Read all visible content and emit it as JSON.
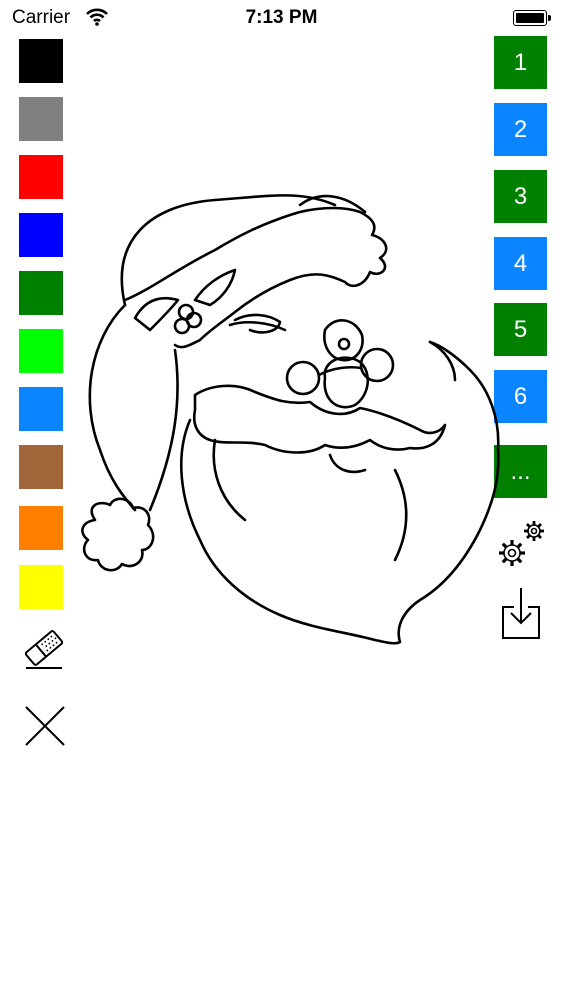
{
  "status_bar": {
    "carrier": "Carrier",
    "time": "7:13 PM",
    "icons": [
      "wifi-icon",
      "battery-icon"
    ]
  },
  "palette": {
    "colors": [
      "#000000",
      "#808080",
      "#ff0000",
      "#0000ff",
      "#008000",
      "#00ff00",
      "#0a84ff",
      "#a0663a",
      "#ff8000",
      "#ffff00"
    ],
    "tools": [
      "eraser-icon",
      "clear-icon"
    ]
  },
  "pages": {
    "buttons": [
      {
        "label": "1",
        "color": "#008000"
      },
      {
        "label": "2",
        "color": "#0a84ff"
      },
      {
        "label": "3",
        "color": "#008000"
      },
      {
        "label": "4",
        "color": "#0a84ff"
      },
      {
        "label": "5",
        "color": "#008000"
      },
      {
        "label": "6",
        "color": "#0a84ff"
      }
    ],
    "more_label": "...",
    "more_color": "#008000"
  },
  "actions": [
    "settings-icon",
    "save-icon"
  ],
  "canvas": {
    "image": "santa-coloring-page"
  }
}
